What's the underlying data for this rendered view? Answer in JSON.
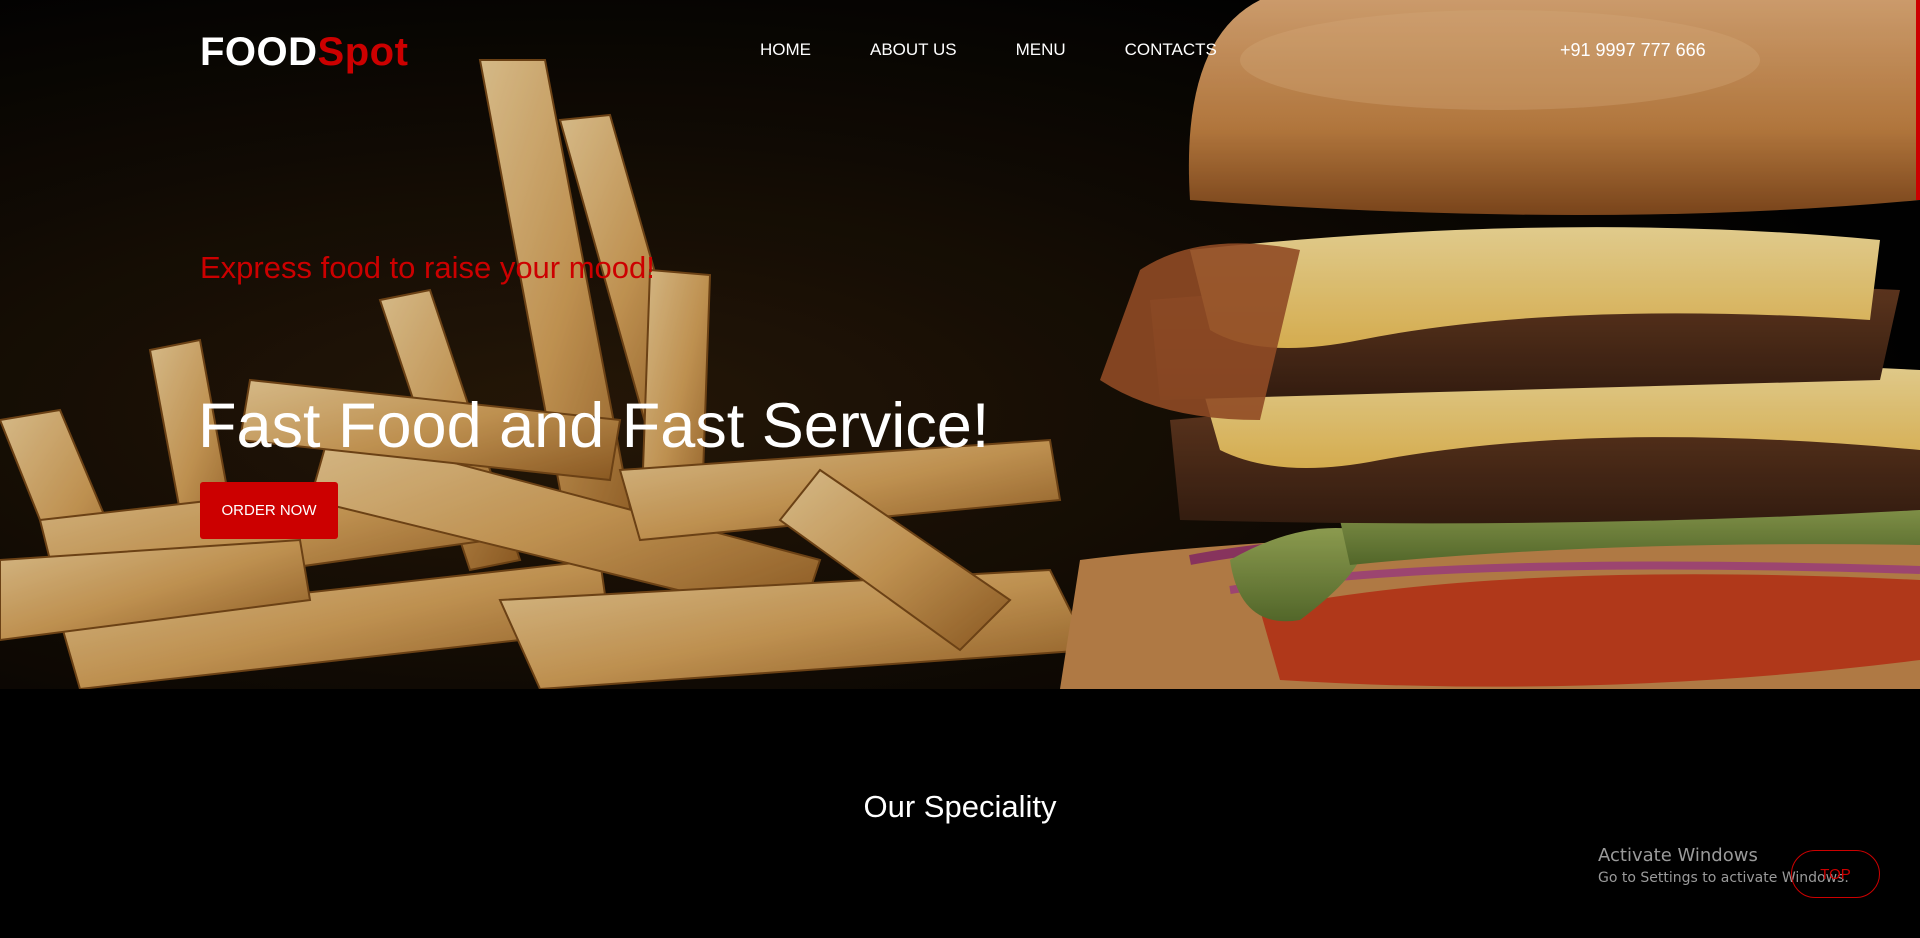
{
  "brand": {
    "part1": "FOOD",
    "part2": "Spot"
  },
  "nav": {
    "items": [
      "HOME",
      "ABOUT US",
      "MENU",
      "CONTACTS"
    ]
  },
  "contact": {
    "phone": "+91 9997 777 666"
  },
  "hero": {
    "tagline": "Express food to raise your mood!",
    "headline": "Fast Food and Fast Service!",
    "cta_label": "ORDER NOW"
  },
  "speciality": {
    "title": "Our Speciality"
  },
  "scroll_top": {
    "label": "TOP"
  },
  "windows_notice": {
    "title": "Activate Windows",
    "subtitle": "Go to Settings to activate Windows."
  },
  "colors": {
    "accent": "#cc0000",
    "background": "#000000",
    "text": "#ffffff"
  }
}
